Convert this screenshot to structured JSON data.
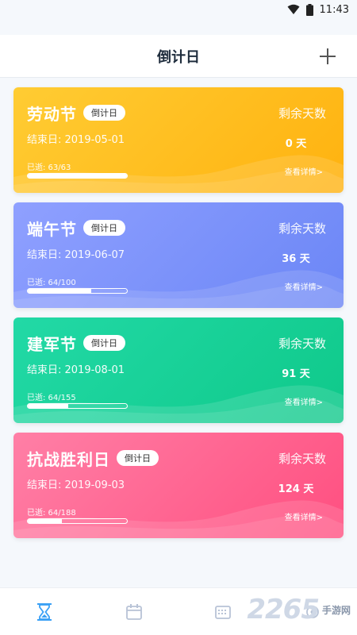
{
  "status_bar": {
    "time": "11:43"
  },
  "header": {
    "title": "倒计日"
  },
  "cards": [
    {
      "name": "劳动节",
      "badge": "倒计日",
      "end_label": "结束日: 2019-05-01",
      "elapsed_label": "已逝:  63/63",
      "progress": 1.0,
      "remain_label": "剩余天数",
      "remain_days": "0 天",
      "detail": "查看详情>",
      "color_from": "#ffcc33",
      "color_to": "#ffb20f"
    },
    {
      "name": "端午节",
      "badge": "倒计日",
      "end_label": "结束日: 2019-06-07",
      "elapsed_label": "已逝:  64/100",
      "progress": 0.64,
      "remain_label": "剩余天数",
      "remain_days": "36 天",
      "detail": "查看详情>",
      "color_from": "#8fa0ff",
      "color_to": "#6b86f6"
    },
    {
      "name": "建军节",
      "badge": "倒计日",
      "end_label": "结束日: 2019-08-01",
      "elapsed_label": "已逝:  64/155",
      "progress": 0.41,
      "remain_label": "剩余天数",
      "remain_days": "91 天",
      "detail": "查看详情>",
      "color_from": "#22d9a6",
      "color_to": "#0fc98a"
    },
    {
      "name": "抗战胜利日",
      "badge": "倒计日",
      "end_label": "结束日: 2019-09-03",
      "elapsed_label": "已逝:  64/188",
      "progress": 0.34,
      "remain_label": "剩余天数",
      "remain_days": "124 天",
      "detail": "查看详情>",
      "color_from": "#ff7fa6",
      "color_to": "#ff4f80"
    }
  ],
  "tabs": [
    {
      "icon": "hourglass-icon",
      "active": true
    },
    {
      "icon": "calendar-icon",
      "active": false
    },
    {
      "icon": "keyboard-calendar-icon",
      "active": false
    },
    {
      "icon": "settings-icon",
      "active": false
    }
  ],
  "watermark": {
    "number": "2265",
    "text": "手游网"
  },
  "colors": {
    "accent": "#3aa0f5",
    "tab_inactive": "#b8c3d6"
  }
}
